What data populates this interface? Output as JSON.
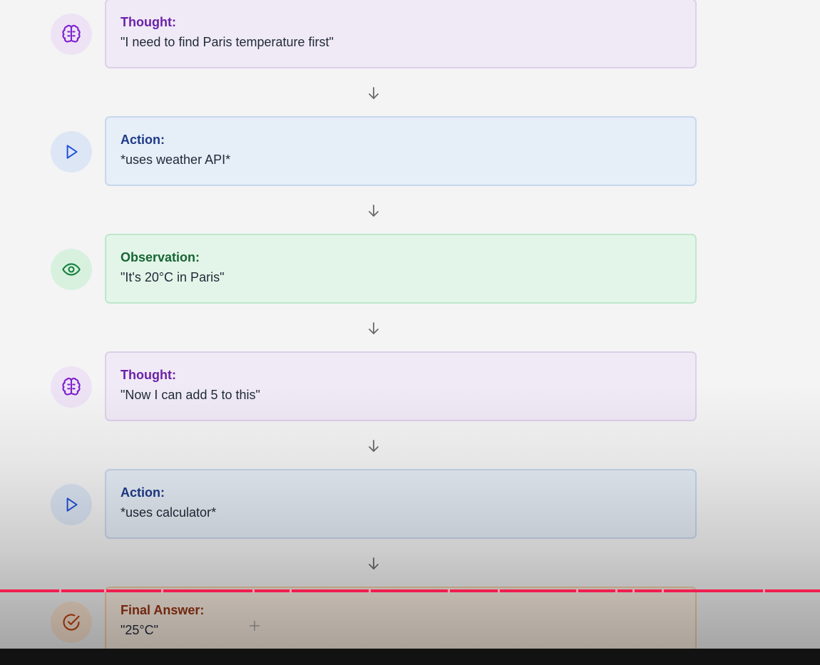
{
  "steps": [
    {
      "kind": "thought",
      "title": "Thought:",
      "text": "\"I need to find Paris temperature first\"",
      "icon": "brain-icon"
    },
    {
      "kind": "action",
      "title": "Action:",
      "text": "*uses weather API*",
      "icon": "play-icon"
    },
    {
      "kind": "observation",
      "title": "Observation:",
      "text": "\"It's 20°C in Paris\"",
      "icon": "eye-icon"
    },
    {
      "kind": "thought",
      "title": "Thought:",
      "text": "\"Now I can add 5 to this\"",
      "icon": "brain-icon"
    },
    {
      "kind": "action",
      "title": "Action:",
      "text": "*uses calculator*",
      "icon": "play-icon"
    },
    {
      "kind": "final",
      "title": "Final Answer:",
      "text": "\"25°C\"",
      "icon": "check-circle-icon"
    }
  ],
  "connector_icon": "arrow-down-icon",
  "colors": {
    "thought": "#6b21a8",
    "action": "#1e3a8a",
    "observation": "#166534",
    "final": "#9a3412",
    "progress": "#ef1e4f"
  },
  "video": {
    "progress": 1.0
  }
}
